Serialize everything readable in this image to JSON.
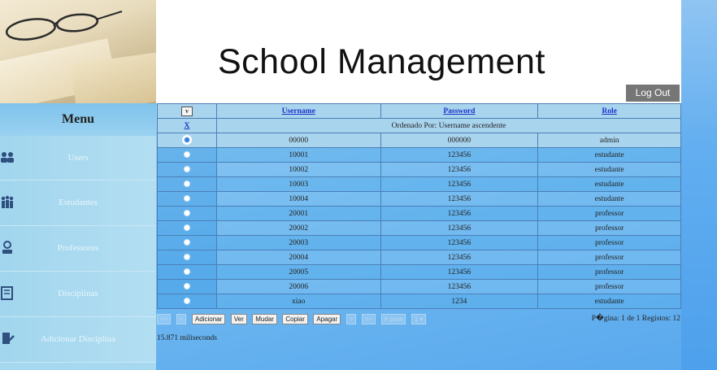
{
  "header": {
    "title": "School Management",
    "logout_label": "Log Out"
  },
  "sidebar": {
    "menu_title": "Menu",
    "items": [
      {
        "label": "Users",
        "icon": "users-icon"
      },
      {
        "label": "Estudantes",
        "icon": "students-icon"
      },
      {
        "label": "Professores",
        "icon": "teacher-icon"
      },
      {
        "label": "Disciplinas",
        "icon": "book-icon"
      },
      {
        "label": "Adicionar Disciplina",
        "icon": "add-discipline-icon"
      }
    ]
  },
  "table": {
    "select_header": "v",
    "columns": [
      "Username",
      "Password",
      "Role"
    ],
    "clear_order": "X",
    "order_text": "Ordenado Por: Username ascendente",
    "rows": [
      {
        "username": "00000",
        "password": "000000",
        "role": "admin",
        "selected": true
      },
      {
        "username": "10001",
        "password": "123456",
        "role": "estudante",
        "selected": false
      },
      {
        "username": "10002",
        "password": "123456",
        "role": "estudante",
        "selected": false
      },
      {
        "username": "10003",
        "password": "123456",
        "role": "estudante",
        "selected": false
      },
      {
        "username": "10004",
        "password": "123456",
        "role": "estudante",
        "selected": false
      },
      {
        "username": "20001",
        "password": "123456",
        "role": "professor",
        "selected": false
      },
      {
        "username": "20002",
        "password": "123456",
        "role": "professor",
        "selected": false
      },
      {
        "username": "20003",
        "password": "123456",
        "role": "professor",
        "selected": false
      },
      {
        "username": "20004",
        "password": "123456",
        "role": "professor",
        "selected": false
      },
      {
        "username": "20005",
        "password": "123456",
        "role": "professor",
        "selected": false
      },
      {
        "username": "20006",
        "password": "123456",
        "role": "professor",
        "selected": false
      },
      {
        "username": "xiao",
        "password": "1234",
        "role": "estudante",
        "selected": false
      }
    ]
  },
  "toolbar": {
    "first": "<<",
    "prev": "<",
    "add": "Adicionar",
    "view": "Ver",
    "edit": "Mudar",
    "copy": "Copiar",
    "delete": "Apagar",
    "next": ">",
    "last": ">>",
    "goto": "ir para",
    "page_select": "1 ▾"
  },
  "pager": {
    "info": "P�gina: 1 de 1  Registos: 12"
  },
  "footer": {
    "timing": "15.871 miliseconds"
  },
  "colors": {
    "header_cell": "#a9d4ee",
    "link": "#1a35c8",
    "logout_bg": "#767676"
  }
}
